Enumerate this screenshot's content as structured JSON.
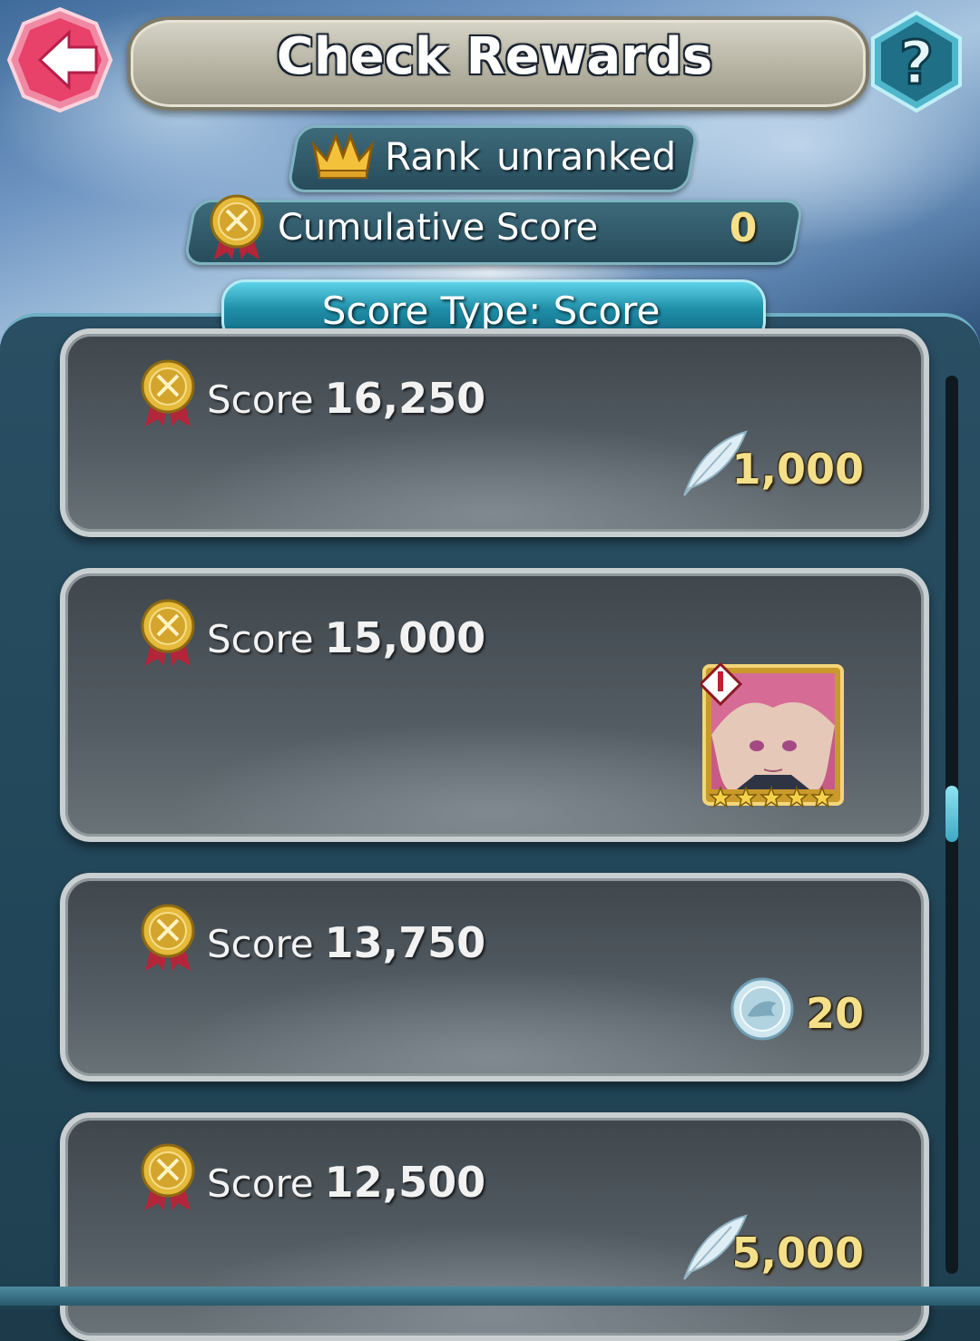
{
  "header": {
    "title": "Check Rewards",
    "back_icon": "back-arrow-icon",
    "help_label": "?"
  },
  "rank": {
    "label": "Rank",
    "value": "unranked"
  },
  "cumulative": {
    "label": "Cumulative Score",
    "value": "0"
  },
  "score_type": {
    "label": "Score Type: Score"
  },
  "rewards": [
    {
      "score_label": "Score",
      "score_value": "16,250",
      "reward_type": "feather",
      "reward_amount": "1,000"
    },
    {
      "score_label": "Score",
      "score_value": "15,000",
      "reward_type": "hero",
      "reward_rarity_stars": 5
    },
    {
      "score_label": "Score",
      "score_value": "13,750",
      "reward_type": "badge-coin",
      "reward_amount": "20"
    },
    {
      "score_label": "Score",
      "score_value": "12,500",
      "reward_type": "feather",
      "reward_amount": "5,000"
    }
  ],
  "colors": {
    "accent_gold": "#f5e08a",
    "tab_cyan": "#1f8ea8",
    "back_pink": "#e8416a",
    "help_teal": "#2a8fa8"
  }
}
